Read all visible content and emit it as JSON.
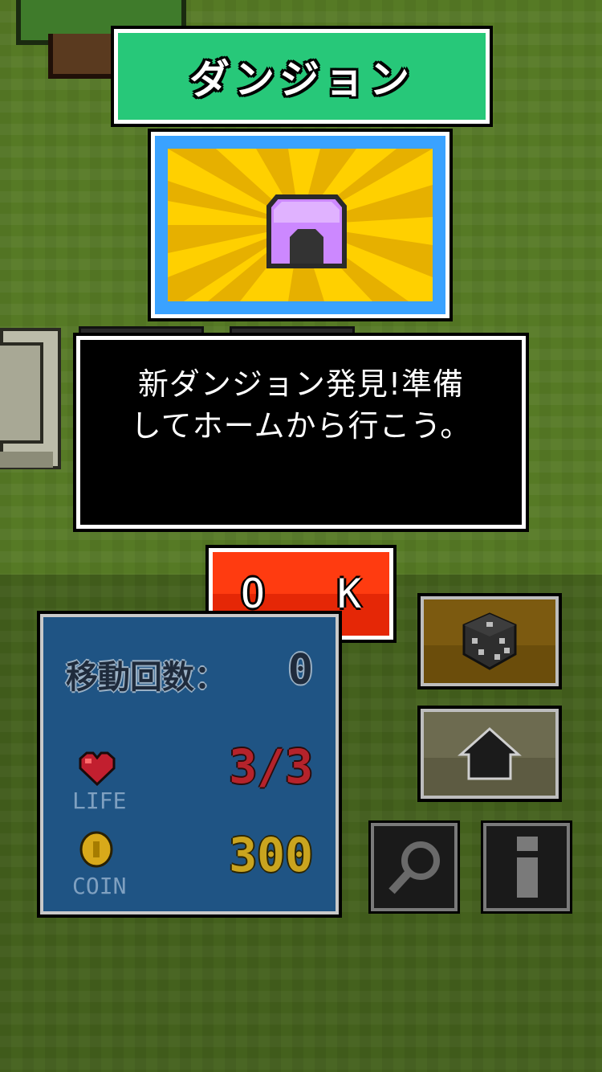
{
  "dialog": {
    "title": "ダンジョン",
    "message_lines": [
      "新ダンジョン発見!準備",
      "してホームから行こう。"
    ],
    "ok_label": "O K"
  },
  "stats": {
    "moves_label": "移動回数：",
    "moves_value": "0",
    "life_label": "LIFE",
    "life_value": "3/3",
    "coin_label": "COIN",
    "coin_value": "300"
  },
  "icons": {
    "dungeon": "dungeon-entrance-icon",
    "dice": "dice-icon",
    "home": "home-icon",
    "search": "magnifier-icon",
    "info": "info-icon",
    "heart": "heart-icon",
    "coin": "coin-icon"
  },
  "colors": {
    "title_banner": "#27c879",
    "card_border": "#3aa2ff",
    "card_background": "#ffd000",
    "ok_button": "#ff3b10",
    "stats_panel": "#1f5484",
    "life_value": "#b5232b",
    "coin_value": "#c9a41f"
  }
}
